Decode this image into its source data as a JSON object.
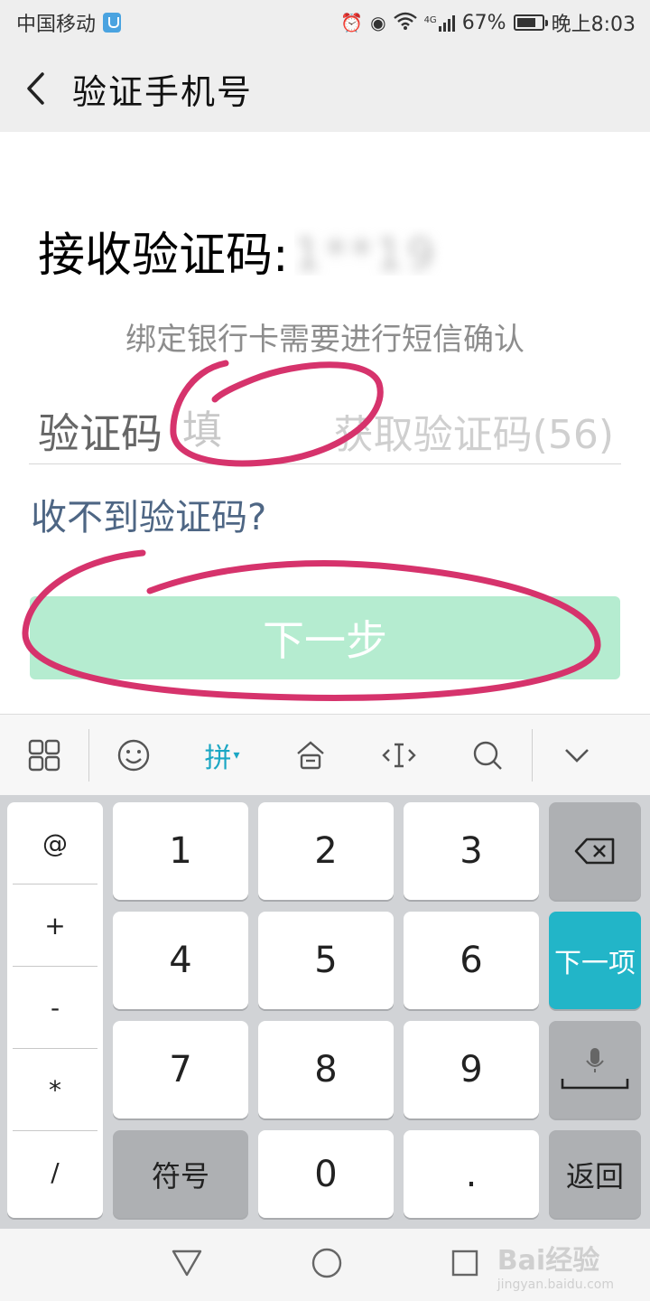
{
  "status_bar": {
    "carrier": "中国移动",
    "network": "4G",
    "battery": "67%",
    "time": "晚上8:03"
  },
  "header": {
    "title": "验证手机号"
  },
  "content": {
    "receive_label": "接收验证码:",
    "masked_number": "1**19",
    "subtitle": "绑定银行卡需要进行短信确认",
    "code_label": "验证码",
    "code_placeholder": "填",
    "get_code": "获取验证码(56)",
    "no_code_link": "收不到验证码?",
    "next_button": "下一步"
  },
  "keyboard": {
    "toolbar": {
      "pinyin": "拼"
    },
    "symbols": [
      "@",
      "+",
      "-",
      "*",
      "/"
    ],
    "keys": {
      "k1": "1",
      "k2": "2",
      "k3": "3",
      "k4": "4",
      "k5": "5",
      "k6": "6",
      "k7": "7",
      "k8": "8",
      "k9": "9",
      "symbol": "符号",
      "k0": "0",
      "dot": ".",
      "next_field": "下一项",
      "return": "返回"
    }
  },
  "watermark": {
    "brand": "Bai经验",
    "url": "jingyan.baidu.com"
  },
  "colors": {
    "accent_teal": "#22b5c8",
    "next_button_disabled": "#b5ecd0",
    "annotation": "#d6336c",
    "link": "#4e6684"
  }
}
